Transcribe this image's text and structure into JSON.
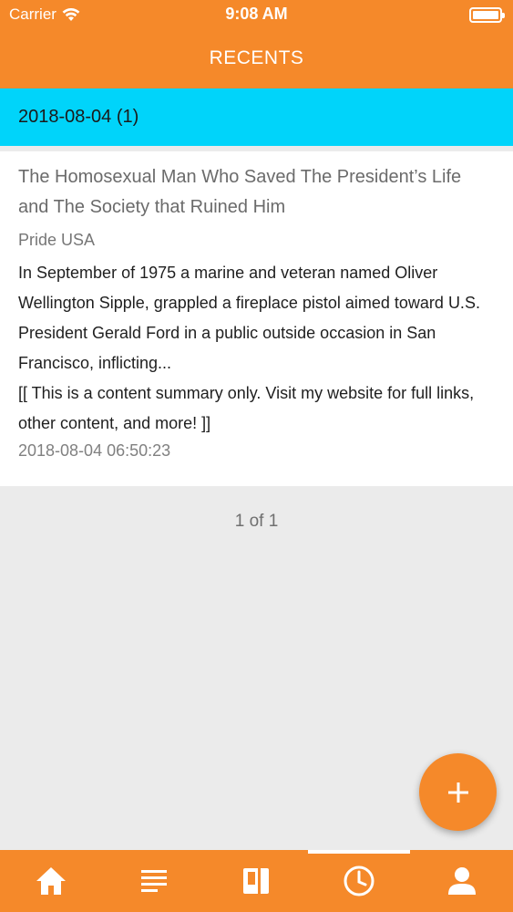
{
  "status_bar": {
    "carrier": "Carrier",
    "time": "9:08 AM"
  },
  "header": {
    "title": "RECENTS"
  },
  "group": {
    "title": "2018-08-04 (1)"
  },
  "article": {
    "title": "The Homosexual Man Who Saved The President’s Life and The Society that Ruined Him",
    "source": "Pride USA",
    "summary": "In September of 1975 a marine and veteran named Oliver Wellington Sipple, grappled a fireplace pistol aimed toward U.S. President Gerald Ford in a public outside occasion in San Francisco, inflicting...",
    "note": "[[ This is a content summary only. Visit my website for full links, other content, and more! ]]",
    "datetime": "2018-08-04 06:50:23"
  },
  "pagination": {
    "label": "1 of 1"
  },
  "fab": {
    "icon": "plus-icon"
  },
  "bottom_nav": {
    "items": [
      {
        "icon": "home-icon",
        "active": false
      },
      {
        "icon": "list-icon",
        "active": false
      },
      {
        "icon": "book-icon",
        "active": false
      },
      {
        "icon": "clock-icon",
        "active": true
      },
      {
        "icon": "person-icon",
        "active": false
      }
    ]
  },
  "colors": {
    "primary": "#f5892a",
    "group_header": "#00d4fa",
    "background": "#ebebeb"
  }
}
